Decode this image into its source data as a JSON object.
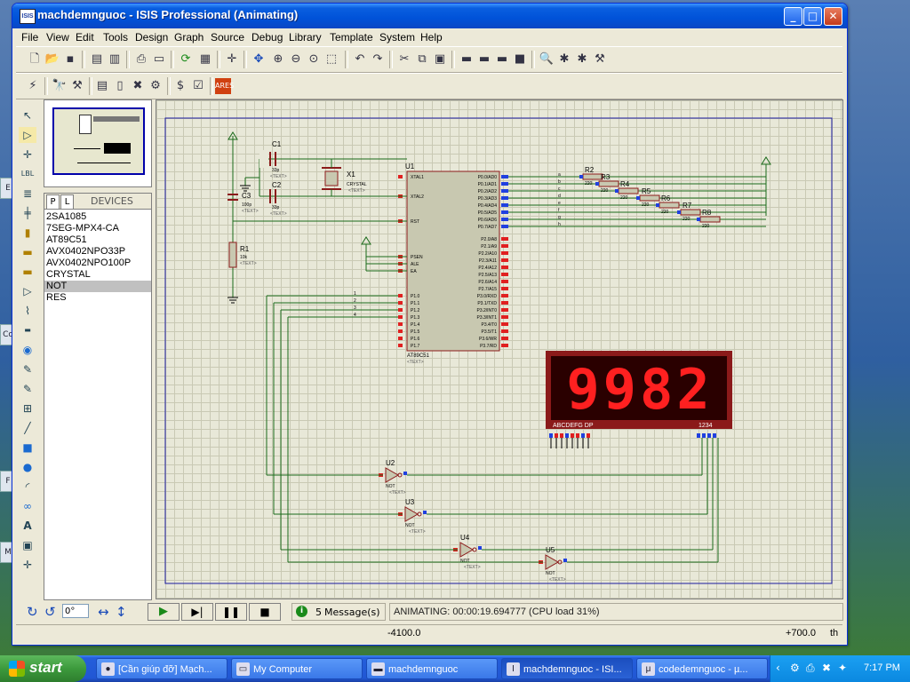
{
  "window": {
    "app_icon": "ISIS",
    "title": "machdemnguoc - ISIS Professional (Animating)",
    "controls": [
      "_",
      "□",
      "✕"
    ]
  },
  "menu": [
    "File",
    "View",
    "Edit",
    "Tools",
    "Design",
    "Graph",
    "Source",
    "Debug",
    "Library",
    "Template",
    "System",
    "Help"
  ],
  "devices": {
    "tabs": [
      "P",
      "L"
    ],
    "header": "DEVICES",
    "items": [
      "2SA1085",
      "7SEG-MPX4-CA",
      "AT89C51",
      "AVX0402NPO33P",
      "AVX0402NPO100P",
      "CRYSTAL",
      "NOT",
      "RES"
    ],
    "selected": "NOT"
  },
  "schematic": {
    "components": {
      "u1": {
        "ref": "U1",
        "part": "AT89C51",
        "text": "<TEXT>"
      },
      "x1": {
        "ref": "X1",
        "part": "CRYSTAL",
        "text": "<TEXT>"
      },
      "c1": {
        "ref": "C1",
        "value": "33p",
        "text": "<TEXT>"
      },
      "c2": {
        "ref": "C2",
        "value": "33p",
        "text": "<TEXT>"
      },
      "c3": {
        "ref": "C3",
        "value": "100p",
        "text": "<TEXT>"
      },
      "r1": {
        "ref": "R1",
        "value": "10k",
        "text": "<TEXT>"
      },
      "u2": {
        "ref": "U2",
        "part": "NOT",
        "text": "<TEXT>"
      },
      "u3": {
        "ref": "U3",
        "part": "NOT",
        "text": "<TEXT>"
      },
      "u4": {
        "ref": "U4",
        "part": "NOT",
        "text": "<TEXT>"
      },
      "u5": {
        "ref": "U5",
        "part": "NOT",
        "text": "<TEXT>"
      }
    },
    "resistors": [
      "R2",
      "R3",
      "R4",
      "R5",
      "R6",
      "R7",
      "R8"
    ],
    "resistor_value": "220",
    "segment_letters": [
      "a",
      "b",
      "c",
      "d",
      "e",
      "f",
      "g",
      "h"
    ],
    "u1_left_pins": [
      "XTAL1",
      "XTAL2",
      "RST",
      "PSEN",
      "ALE",
      "EA",
      "P1.0",
      "P1.1",
      "P1.2",
      "P1.3",
      "P1.4",
      "P1.5",
      "P1.6",
      "P1.7"
    ],
    "u1_right_pins": [
      "P0.0/AD0",
      "P0.1/AD1",
      "P0.2/AD2",
      "P0.3/AD3",
      "P0.4/AD4",
      "P0.5/AD5",
      "P0.6/AD6",
      "P0.7/AD7",
      "P2.0/A8",
      "P2.1/A9",
      "P2.2/A10",
      "P2.3/A11",
      "P2.4/A12",
      "P2.5/A13",
      "P2.6/A14",
      "P2.7/A15",
      "P3.0/RXD",
      "P3.1/TXD",
      "P3.2/INT0",
      "P3.3/INT1",
      "P3.4/T0",
      "P3.5/T1",
      "P3.6/WR",
      "P3.7/RD"
    ],
    "display": {
      "digits": "9982",
      "segment_label": "ABCDEFG DP",
      "digit_label": "1234",
      "color": "#ff1a1a"
    }
  },
  "sim": {
    "rotation": "0°",
    "messages_count": "5",
    "messages_text": "Message(s)",
    "status": "ANIMATING: 00:00:19.694777 (CPU load 31%)"
  },
  "status": {
    "x_coord": "-4100.0",
    "y_coord": "+700.0",
    "units": "th"
  },
  "taskbar": {
    "start": "start",
    "tasks": [
      {
        "label": "[Cần giúp đỡ] Mạch...",
        "icon": "firefox-icon"
      },
      {
        "label": "My Computer",
        "icon": "computer-icon"
      },
      {
        "label": "machdemnguoc",
        "icon": "folder-icon"
      },
      {
        "label": "machdemnguoc - ISI...",
        "icon": "isis-icon"
      },
      {
        "label": "codedemnguoc - µ...",
        "icon": "keil-icon"
      }
    ],
    "clock": "7:17 PM"
  }
}
